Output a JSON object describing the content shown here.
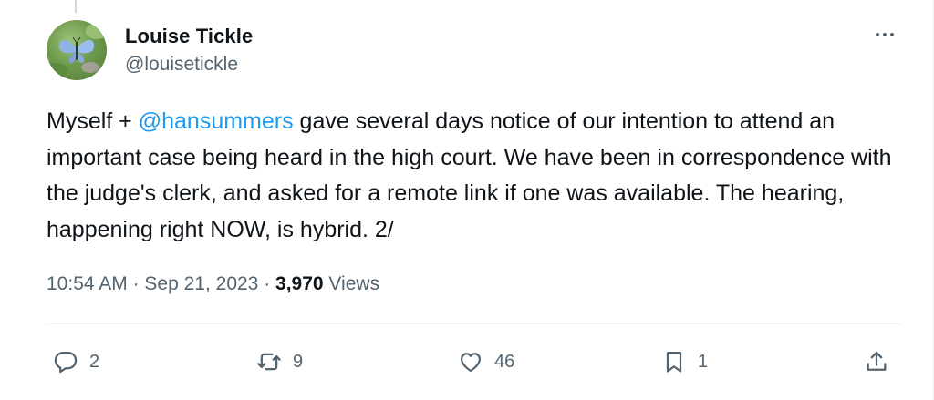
{
  "author": {
    "name": "Louise Tickle",
    "handle": "@louisetickle"
  },
  "tweet": {
    "text_before_mention": "Myself + ",
    "mention": "@hansummers",
    "text_after_mention": " gave several days notice of our intention to attend an important case being heard in the high court. We have been in correspondence with the judge's clerk, and asked for a remote link if one was available. The hearing, happening right NOW, is hybrid. 2/"
  },
  "meta": {
    "time": "10:54 AM",
    "separator1": " · ",
    "date": "Sep 21, 2023",
    "separator2": " · ",
    "views_count": "3,970",
    "views_label": " Views"
  },
  "actions": {
    "reply": {
      "icon": "reply-icon",
      "count": "2"
    },
    "retweet": {
      "icon": "retweet-icon",
      "count": "9"
    },
    "like": {
      "icon": "heart-icon",
      "count": "46"
    },
    "bookmark": {
      "icon": "bookmark-icon",
      "count": "1"
    },
    "share": {
      "icon": "share-icon"
    }
  },
  "colors": {
    "text": "#0f1419",
    "secondary": "#536471",
    "link": "#1d9bf0",
    "divider": "#eff3f4"
  }
}
